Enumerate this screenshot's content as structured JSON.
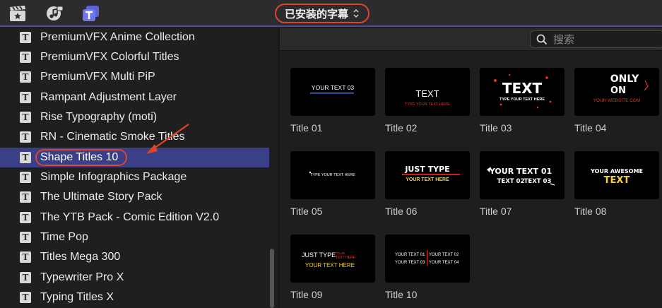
{
  "toolbar": {
    "icons": [
      "clapper-star-icon",
      "music-photo-icon",
      "titles-icon"
    ],
    "dropdown_label": "已安装的字幕",
    "dropdown_chevron": "⌃⌄"
  },
  "sidebar": {
    "items": [
      {
        "label": "PremiumVFX Anime Collection"
      },
      {
        "label": "PremiumVFX Colorful Titles"
      },
      {
        "label": "PremiumVFX Multi PiP"
      },
      {
        "label": "Rampant Adjustment Layer"
      },
      {
        "label": "Rise Typography (moti)"
      },
      {
        "label": "RN - Cinematic Smoke Titles"
      },
      {
        "label": "Shape Titles 10",
        "selected": true
      },
      {
        "label": "Simple Infographics Package"
      },
      {
        "label": "The Ultimate Story Pack"
      },
      {
        "label": "The YTB Pack - Comic Edition V2.0"
      },
      {
        "label": "Time Pop"
      },
      {
        "label": "Titles Mega 300"
      },
      {
        "label": "Typewriter Pro X"
      },
      {
        "label": "Typing Titles X"
      }
    ],
    "item_icon_glyph": "T"
  },
  "search": {
    "placeholder": "搜索"
  },
  "tiles": [
    {
      "label": "Title 01",
      "thumb": {
        "line1": "YOUR TEXT 03"
      }
    },
    {
      "label": "Title 02",
      "thumb": {
        "line1": "TEXT",
        "line2": "TYPE YOUR TEXT HERE"
      }
    },
    {
      "label": "Title 03",
      "thumb": {
        "line1": "TEXT",
        "line2": "TYPE YOUR TEXT HERE"
      }
    },
    {
      "label": "Title 04",
      "thumb": {
        "line1": "ONLY",
        "line2": "ON",
        "line3": "YOUR WEBSITE.COM"
      }
    },
    {
      "label": "Title 05",
      "thumb": {
        "line1": "TYPE YOUR TEXT HERE"
      }
    },
    {
      "label": "Title 06",
      "thumb": {
        "line1": "JUST TYPE",
        "line2": "YOUR TEXT HERE"
      }
    },
    {
      "label": "Title 07",
      "thumb": {
        "line1": "YOUR TEXT 01",
        "line2": "TEXT 02",
        "line3": "TEXT 03"
      }
    },
    {
      "label": "Title 08",
      "thumb": {
        "line1": "YOUR AWESOME",
        "line2": "TEXT"
      }
    },
    {
      "label": "Title 09",
      "thumb": {
        "line1": "JUST TYPE",
        "line2": "YOUR",
        "line3": "TEXT HERE",
        "line4": "YOUR TEXT HERE"
      }
    },
    {
      "label": "Title 10",
      "thumb": {
        "line1": "YOUR TEXT 01",
        "line2": "YOUR TEXT 02",
        "line3": "YOUR TEXT 03",
        "line4": "YOUR TEXT 04"
      }
    }
  ],
  "colors": {
    "accent_selection": "#3a3f88",
    "annotation_red": "#e0432c",
    "thumb_red": "#e2352b",
    "thumb_yellow": "#f5d13a",
    "thumb_blue": "#3c6cf0"
  }
}
